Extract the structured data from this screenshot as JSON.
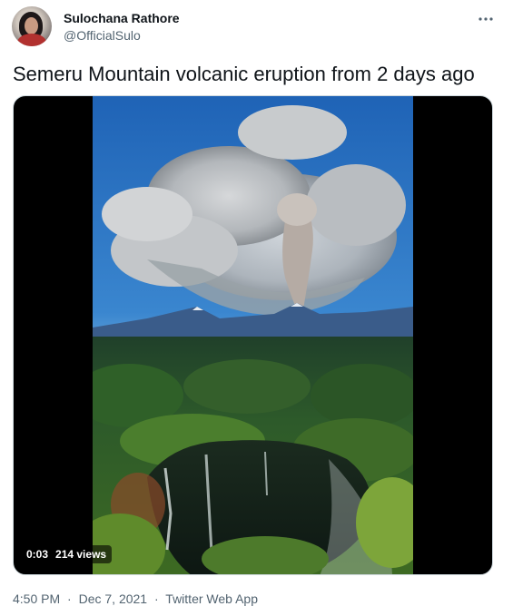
{
  "author": {
    "display_name": "Sulochana Rathore",
    "handle": "@OfficialSulo",
    "avatar_icon": "profile-photo"
  },
  "more_icon": "more-horizontal-icon",
  "tweet": {
    "text": "Semeru Mountain volcanic eruption from 2 days ago"
  },
  "media": {
    "type": "video",
    "time": "0:03",
    "views": "214 views"
  },
  "meta": {
    "time": "4:50 PM",
    "separator": "·",
    "date": "Dec 7, 2021",
    "client": "Twitter Web App"
  },
  "colors": {
    "text_primary": "#0f1419",
    "text_secondary": "#536471",
    "border": "#cfd9de"
  }
}
